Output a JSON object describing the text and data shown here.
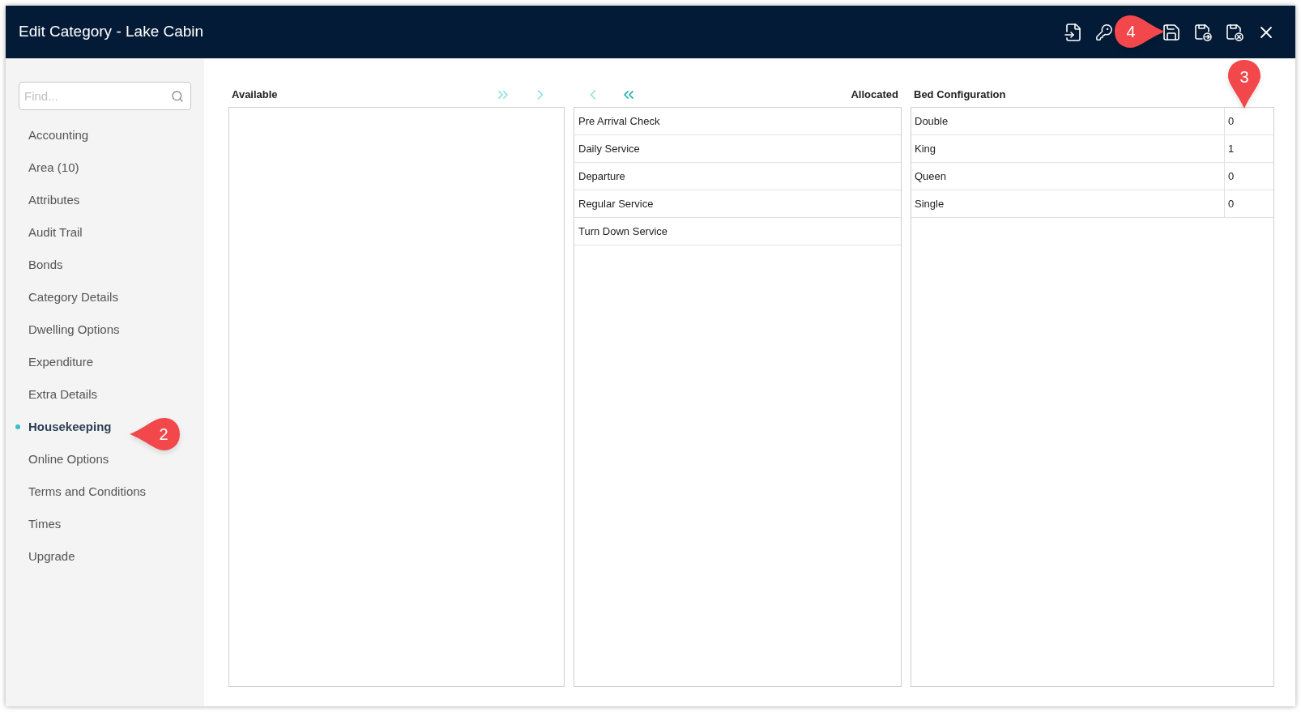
{
  "window": {
    "title": "Edit Category - Lake Cabin"
  },
  "sidebar": {
    "search": {
      "placeholder": "Find..."
    },
    "items": [
      {
        "label": "Accounting",
        "selected": false
      },
      {
        "label": "Area (10)",
        "selected": false
      },
      {
        "label": "Attributes",
        "selected": false
      },
      {
        "label": "Audit Trail",
        "selected": false
      },
      {
        "label": "Bonds",
        "selected": false
      },
      {
        "label": "Category Details",
        "selected": false
      },
      {
        "label": "Dwelling Options",
        "selected": false
      },
      {
        "label": "Expenditure",
        "selected": false
      },
      {
        "label": "Extra Details",
        "selected": false
      },
      {
        "label": "Housekeeping",
        "selected": true
      },
      {
        "label": "Online Options",
        "selected": false
      },
      {
        "label": "Terms and Conditions",
        "selected": false
      },
      {
        "label": "Times",
        "selected": false
      },
      {
        "label": "Upgrade",
        "selected": false
      }
    ]
  },
  "available": {
    "heading": "Available"
  },
  "transfer_buttons": [
    {
      "kind": "all-right",
      "disabled": true
    },
    {
      "kind": "right",
      "disabled": true
    },
    {
      "kind": "left",
      "disabled": true
    },
    {
      "kind": "all-left",
      "disabled": false
    }
  ],
  "allocated": {
    "heading": "Allocated",
    "items": [
      "Pre Arrival Check",
      "Daily Service",
      "Departure",
      "Regular Service",
      "Turn Down Service"
    ]
  },
  "bed_configuration": {
    "heading": "Bed Configuration",
    "rows": [
      {
        "name": "Double",
        "value": "0"
      },
      {
        "name": "King",
        "value": "1"
      },
      {
        "name": "Queen",
        "value": "0"
      },
      {
        "name": "Single",
        "value": "0"
      }
    ]
  },
  "callouts": [
    {
      "number": "4",
      "kind": "right"
    },
    {
      "number": "2",
      "kind": "left"
    },
    {
      "number": "3",
      "kind": "down"
    }
  ]
}
